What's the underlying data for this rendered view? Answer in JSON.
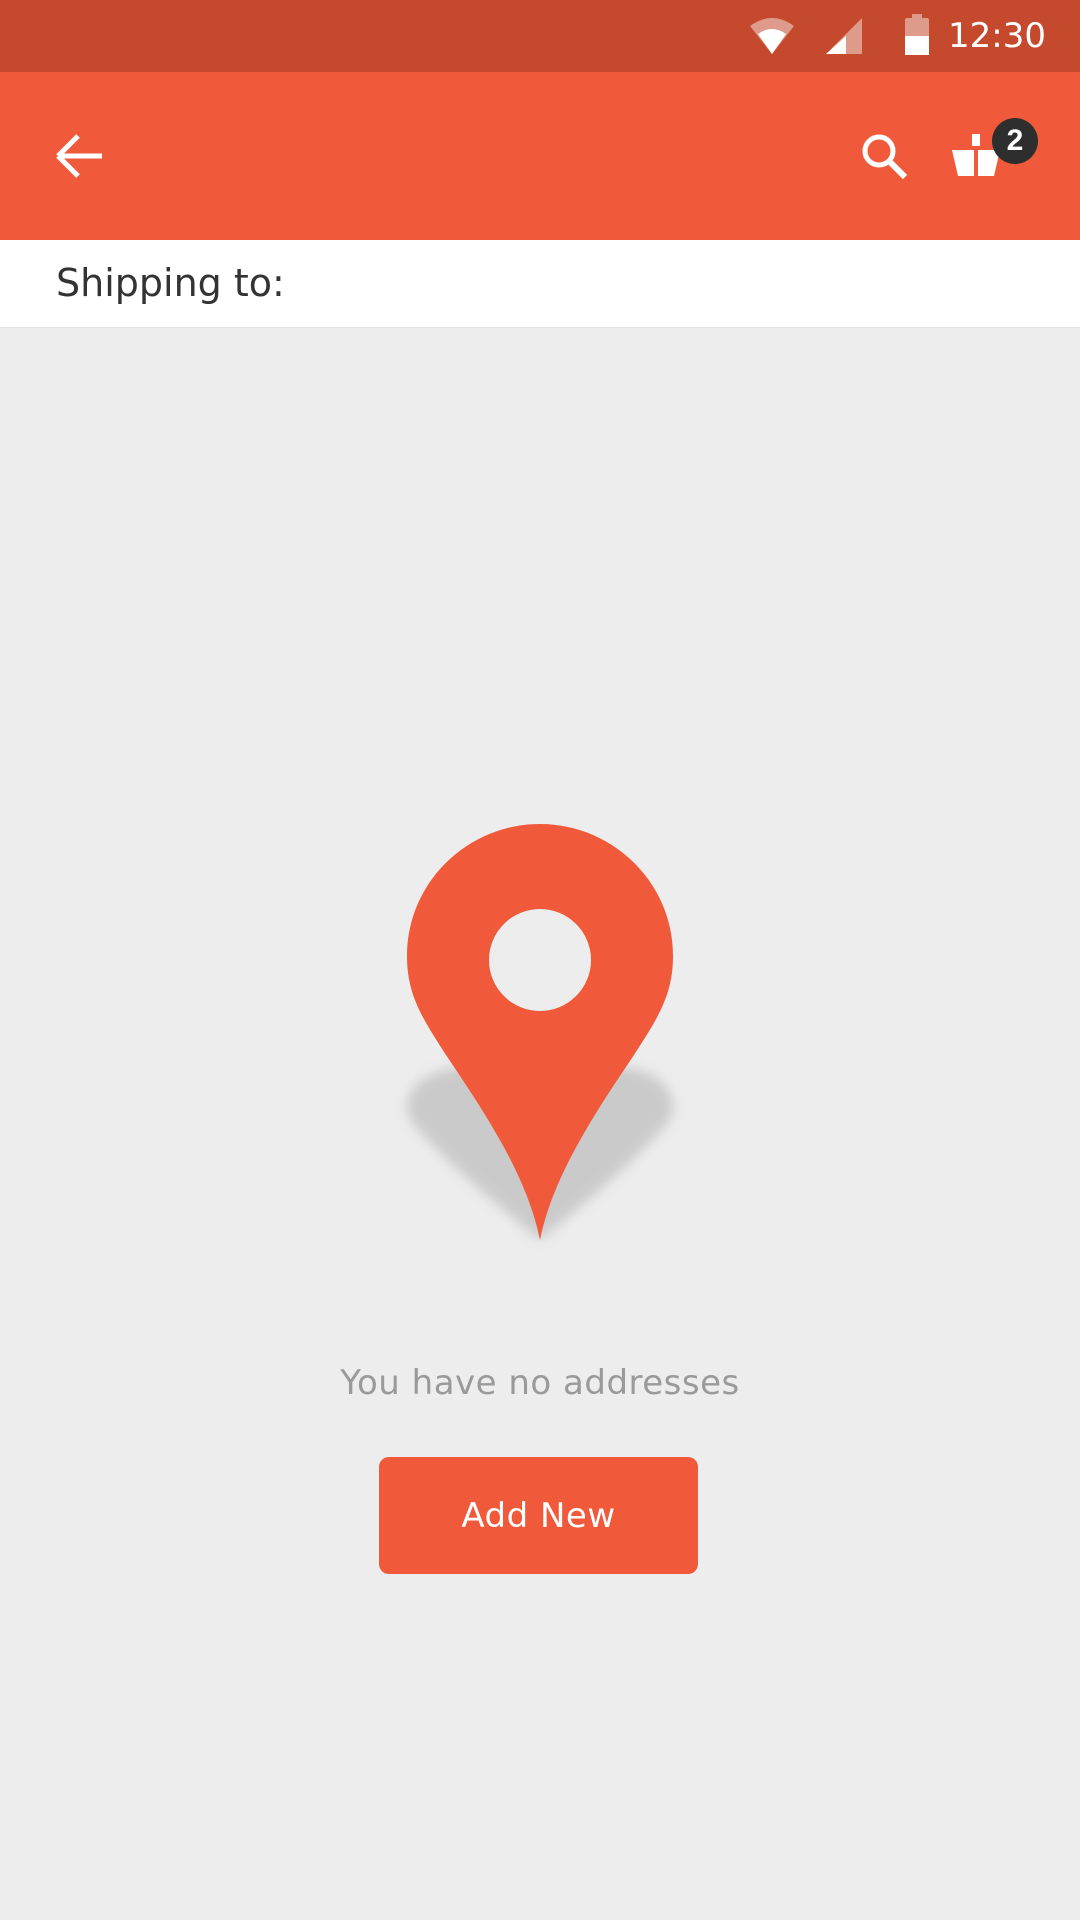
{
  "status_bar": {
    "time": "12:30",
    "icons": [
      "wifi-icon",
      "cell-signal-icon",
      "battery-icon"
    ]
  },
  "app_bar": {
    "icons": [
      "back-arrow-icon",
      "search-icon",
      "shopping-bag-icon"
    ],
    "cart_count": "2",
    "color": "#f05a3a"
  },
  "shipping": {
    "label": "Shipping to:"
  },
  "empty_state": {
    "icon": "location-pin-icon",
    "message": "You have no addresses",
    "button_label": "Add New"
  },
  "colors": {
    "status_bar": "#c4492d",
    "accent": "#f05a3a",
    "background": "#ededed",
    "badge": "#2e2e2e"
  }
}
